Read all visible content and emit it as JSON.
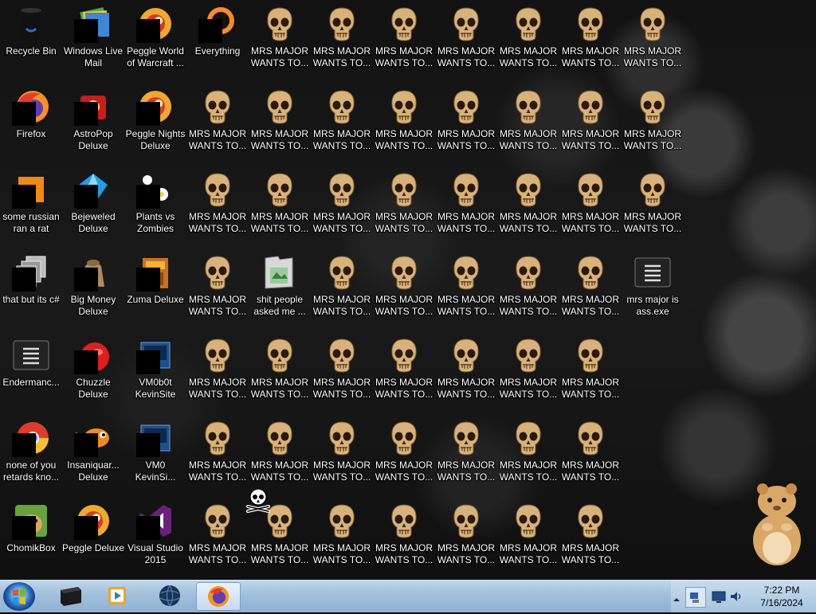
{
  "desktop": {
    "icons": [
      {
        "label": "Recycle Bin",
        "type": "recyclebin"
      },
      {
        "label": "Windows Live\nMail",
        "type": "mail"
      },
      {
        "label": "Peggle World\nof Warcraft ...",
        "type": "peggle"
      },
      {
        "label": "Everything",
        "type": "everything"
      },
      {
        "label": "Firefox",
        "type": "firefox"
      },
      {
        "label": "AstroPop\nDeluxe",
        "type": "astropop"
      },
      {
        "label": "Peggle Nights\nDeluxe",
        "type": "peggle"
      },
      {
        "label": "some russian\nran a rat",
        "type": "app"
      },
      {
        "label": "Bejeweled\nDeluxe",
        "type": "bejeweled"
      },
      {
        "label": "Plants vs\nZombies",
        "type": "pvz"
      },
      {
        "label": "that but its c#",
        "type": "files"
      },
      {
        "label": "Big Money\nDeluxe",
        "type": "bigmoney"
      },
      {
        "label": "Zuma Deluxe",
        "type": "zuma"
      },
      {
        "label": "shit people\nasked me ...",
        "type": "folder"
      },
      {
        "label": "mrs major is\nass.exe",
        "type": "exe"
      },
      {
        "label": "Endermanc...",
        "type": "exe"
      },
      {
        "label": "Chuzzle\nDeluxe",
        "type": "chuzzle"
      },
      {
        "label": "VM0b0t\nKevinSite",
        "type": "vm"
      },
      {
        "label": "none of you\nretards kno...",
        "type": "chrome"
      },
      {
        "label": "Insaniquar...\nDeluxe",
        "type": "fish"
      },
      {
        "label": "VM0\nKevinSi...",
        "type": "vm"
      },
      {
        "label": "ChomikBox",
        "type": "hamster"
      },
      {
        "label": "Peggle Deluxe",
        "type": "peggle"
      },
      {
        "label": "Visual Studio\n2015",
        "type": "vs"
      }
    ],
    "skull_label": "MRS MAJOR\nWANTS TO..."
  },
  "taskbar": {
    "items": [
      {
        "name": "start-orb",
        "active": false
      },
      {
        "name": "taskbar-terminal",
        "active": false
      },
      {
        "name": "taskbar-media",
        "active": false
      },
      {
        "name": "taskbar-globe",
        "active": false
      },
      {
        "name": "taskbar-firefox",
        "active": true
      }
    ],
    "clock": {
      "time": "7:22 PM",
      "date": "7/16/2024"
    }
  },
  "colors": {
    "taskbar": "#9fbfdc",
    "label": "#ffffff",
    "skull": "#d9b27a"
  }
}
